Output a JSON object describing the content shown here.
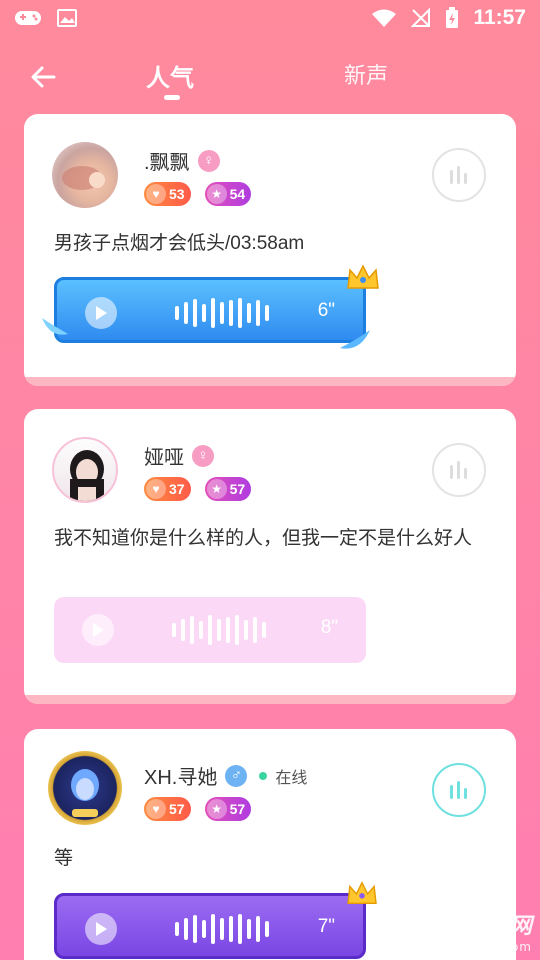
{
  "status_bar": {
    "time": "11:57"
  },
  "header": {
    "tabs": [
      {
        "label": "人气",
        "active": true
      },
      {
        "label": "新声",
        "active": false
      }
    ]
  },
  "posts": [
    {
      "username": ".飘飘",
      "gender": "female",
      "heart_level": "53",
      "star_level": "54",
      "text": "男孩子点烟才会低头/03:58am",
      "duration": "6\"",
      "voice_style": "blue-crown"
    },
    {
      "username": "娅哑",
      "gender": "female",
      "heart_level": "37",
      "star_level": "57",
      "text": "我不知道你是什么样的人，但我一定不是什么好人",
      "duration": "8\"",
      "voice_style": "pink"
    },
    {
      "username": "XH.寻她",
      "gender": "male",
      "online_label": "在线",
      "heart_level": "57",
      "star_level": "57",
      "text": "等",
      "duration": "7\"",
      "voice_style": "purple-crown"
    }
  ],
  "watermark": {
    "main": "007游戏网",
    "sub": "www.yx007.com"
  },
  "colors": {
    "background": "#ff86a4",
    "accent_blue": "#2f8bf0",
    "accent_purple": "#7a46e4",
    "voice_pink": "#fcd8f7"
  }
}
